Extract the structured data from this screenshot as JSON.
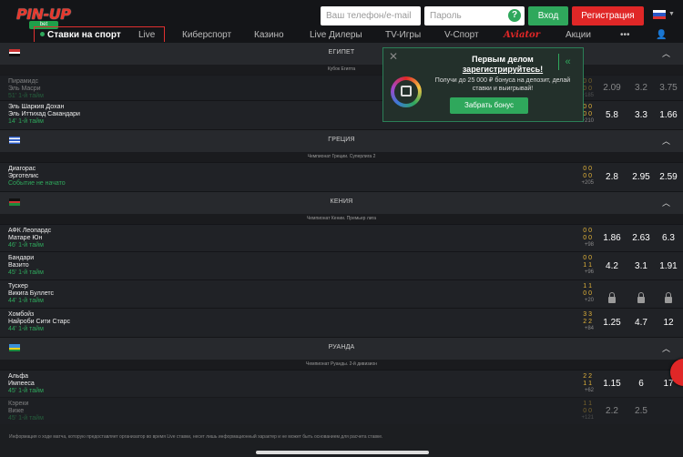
{
  "header": {
    "logo_text": "PIN-UP",
    "logo_sub": "bet",
    "phone_placeholder": "Ваш телефон/e-mail",
    "password_placeholder": "Пароль",
    "help": "?",
    "login_label": "Вход",
    "register_label": "Регистрация"
  },
  "nav": {
    "items": [
      "Ставки на спорт",
      "Live",
      "Киберспорт",
      "Казино",
      "Live Дилеры",
      "TV-Игры",
      "V-Спорт",
      "Aviator",
      "Акции",
      "•••"
    ]
  },
  "popup": {
    "title_line1": "Первым делом",
    "title_line2": "зарегистрируйтесь!",
    "text": "Получи до 25 000 ₽ бонуса на депозит, делай ставки и выигрывай!",
    "button": "Забрать бонус",
    "close": "✕",
    "collapse": "«"
  },
  "countries": [
    {
      "name": "ЕГИПЕТ",
      "league": "Кубок Египта"
    },
    {
      "name": "ГРЕЦИЯ",
      "league": "Чемпионат Греции. Суперлига 2"
    },
    {
      "name": "КЕНИЯ",
      "league": "Чемпионат Кении. Премьер лига"
    },
    {
      "name": "РУАНДА",
      "league": "Чемпионат Руанды. 2-й дивизион"
    }
  ],
  "matches": [
    {
      "team1": "Пирамидс",
      "team2": "Эль Масри",
      "status": "51' 1-й тайм",
      "s1": "0 0",
      "s2": "0 0",
      "more": "+185",
      "odds": [
        "2.09",
        "3.2",
        "3.75"
      ]
    },
    {
      "team1": "Эль Шаркия Доxан",
      "team2": "Эль Иттихад Сакандари",
      "status": "14' 1-й тайм",
      "s1": "0 0",
      "s2": "0 0",
      "more": "+210",
      "odds": [
        "5.8",
        "3.3",
        "1.66"
      ]
    },
    {
      "team1": "Диагорас",
      "team2": "Эрготелис",
      "status": "Событие не начато",
      "s1": "0 0",
      "s2": "0 0",
      "more": "+205",
      "odds": [
        "2.8",
        "2.95",
        "2.59"
      ]
    },
    {
      "team1": "АФК Леопардс",
      "team2": "Матаре Юн",
      "status": "46' 1-й тайм",
      "s1": "0 0",
      "s2": "0 0",
      "more": "+98",
      "odds": [
        "1.86",
        "2.63",
        "6.3"
      ]
    },
    {
      "team1": "Бандари",
      "team2": "Вазито",
      "status": "45' 1-й тайм",
      "s1": "0 0",
      "s2": "1 1",
      "more": "+96",
      "odds": [
        "4.2",
        "3.1",
        "1.91"
      ]
    },
    {
      "team1": "Тускер",
      "team2": "Викига Буллетс",
      "status": "44' 1-й тайм",
      "s1": "1 1",
      "s2": "0 0",
      "more": "+20",
      "odds": []
    },
    {
      "team1": "Хомбойз",
      "team2": "Найроби Сити Старс",
      "status": "44' 1-й тайм",
      "s1": "3 3",
      "s2": "2 2",
      "more": "+84",
      "odds": [
        "1.25",
        "4.7",
        "12"
      ]
    },
    {
      "team1": "Альфа",
      "team2": "Импееса",
      "status": "45' 1-й тайм",
      "s1": "2 2",
      "s2": "1 1",
      "more": "+62",
      "odds": [
        "1.15",
        "6",
        "17"
      ]
    },
    {
      "team1": "Кэреки",
      "team2": "Виже",
      "status": "45' 1-й тайм",
      "s1": "1 1",
      "s2": "0 0",
      "more": "+121",
      "odds": [
        "2.2",
        "2.5",
        ""
      ]
    }
  ],
  "disclaimer": "Информация о ходе матча, которую предоставляет организатор во время Live ставки, несет лишь информационный характер и не может быть основанием для расчета ставке.",
  "colors": {
    "accent_green": "#2fa85c",
    "brand_red": "#e02727",
    "background": "#1c1e21"
  }
}
